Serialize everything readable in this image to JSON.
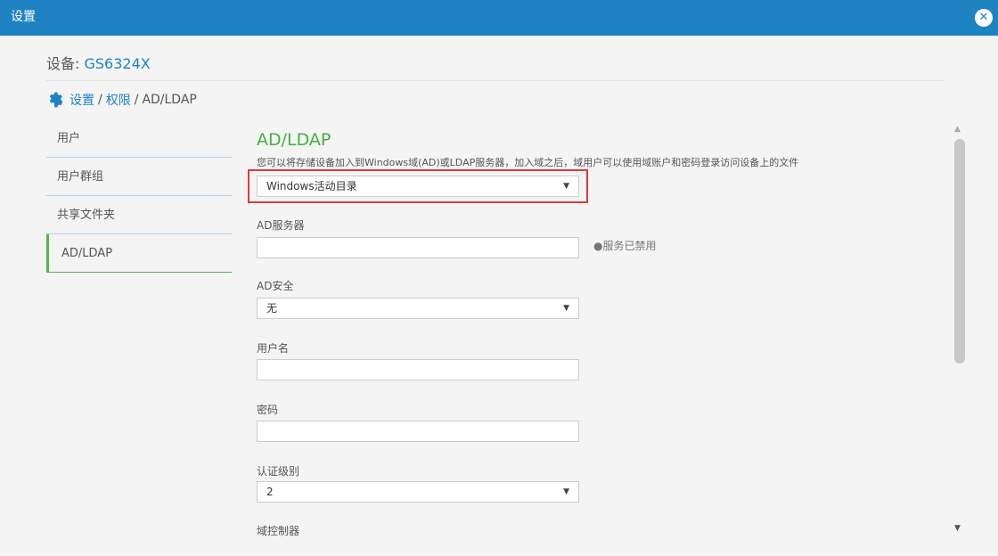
{
  "window": {
    "title": "设置",
    "close_icon": "close-circle-icon"
  },
  "device": {
    "label": "设备: ",
    "name": "GS6324X"
  },
  "breadcrumb": {
    "icon": "gear-icon",
    "part1": "设置",
    "part2": "权限",
    "current": "AD/LDAP",
    "separator": "/"
  },
  "sidebar": {
    "items": [
      {
        "label": "用户"
      },
      {
        "label": "用户群组"
      },
      {
        "label": "共享文件夹"
      },
      {
        "label": "AD/LDAP"
      }
    ]
  },
  "main": {
    "heading": "AD/LDAP",
    "description": "您可以将存储设备加入到Windows域(AD)或LDAP服务器，加入域之后，域用户可以使用域账户和密码登录访问设备上的文件",
    "domain_type": {
      "value": "Windows活动目录"
    },
    "ad_server": {
      "label": "AD服务器",
      "value": "",
      "status": "●服务已禁用"
    },
    "ad_security": {
      "label": "AD安全",
      "value": "无"
    },
    "username": {
      "label": "用户名",
      "value": ""
    },
    "password": {
      "label": "密码",
      "value": ""
    },
    "auth_level": {
      "label": "认证级别",
      "value": "2"
    },
    "domain_controller": {
      "label": "域控制器"
    }
  },
  "colors": {
    "accent": "#1e83c3",
    "heading": "#49ac44",
    "highlight": "#e03a3a"
  }
}
